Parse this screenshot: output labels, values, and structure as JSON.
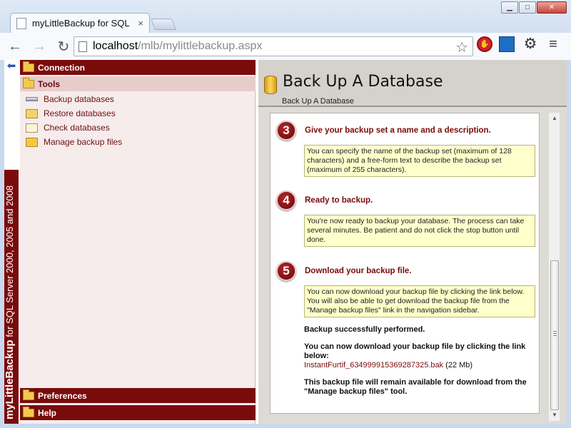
{
  "window": {
    "tab_title": "myLittleBackup for SQL Se",
    "tab_close": "×",
    "controls": {
      "minimize": "▁",
      "maximize": "□",
      "close": "✕"
    }
  },
  "toolbar": {
    "back": "←",
    "forward": "→",
    "reload": "↻",
    "url_host": "localhost",
    "url_path": "/mlb/mylittlebackup.aspx",
    "star": "☆",
    "gear": "⚙",
    "menu": "≡"
  },
  "sidebar": {
    "collapse_arrow": "⬅",
    "brand_name": "myLittleBackup",
    "brand_rest": " for SQL Server 2000, 2005 and 2008",
    "connection_label": "Connection",
    "tools_label": "Tools",
    "tools_items": [
      {
        "label": "Backup databases"
      },
      {
        "label": "Restore databases"
      },
      {
        "label": "Check databases"
      },
      {
        "label": "Manage backup files"
      }
    ],
    "preferences_label": "Preferences",
    "help_label": "Help"
  },
  "main": {
    "title": "Back Up A Database",
    "breadcrumb": "Back Up A Database",
    "steps": [
      {
        "number": "3",
        "title": "Give your backup set a name and a description.",
        "note": "You can specify the name of the backup set (maximum of 128 characters) and a free-form text to describe the backup set (maximum of 255 characters)."
      },
      {
        "number": "4",
        "title": "Ready to backup.",
        "note": "You're now ready to backup your database. The process can take several minutes. Be patient and do not click the stop button until done."
      },
      {
        "number": "5",
        "title": "Download your backup file.",
        "note": "You can now download your backup file by clicking the link below. You will also be able to get download the backup file from the \"Manage backup files\" link in the navigation sidebar."
      }
    ],
    "result": {
      "success": "Backup successfully performed.",
      "download_prompt": "You can now download your backup file by clicking the link below:",
      "file_name": "InstantFurtif_634999915369287325.bak",
      "file_size": "(22 Mb)",
      "availability": "This backup file will remain available for download from the \"Manage backup files\" tool."
    }
  },
  "scrollbar": {
    "up": "▲",
    "down": "▼"
  },
  "colors": {
    "brand": "#7a0b0b",
    "note_bg": "#ffffcc",
    "sidebar_bg": "#f6ecec"
  }
}
